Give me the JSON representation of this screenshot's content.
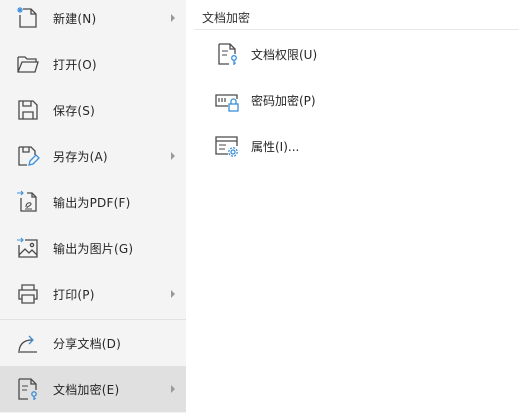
{
  "menu": {
    "items": [
      {
        "label": "新建(N)",
        "icon": "new-document-icon",
        "has_submenu": true
      },
      {
        "label": "打开(O)",
        "icon": "folder-open-icon",
        "has_submenu": false
      },
      {
        "label": "保存(S)",
        "icon": "save-icon",
        "has_submenu": false
      },
      {
        "label": "另存为(A)",
        "icon": "save-as-icon",
        "has_submenu": true
      },
      {
        "label": "输出为PDF(F)",
        "icon": "export-pdf-icon",
        "has_submenu": false
      },
      {
        "label": "输出为图片(G)",
        "icon": "export-image-icon",
        "has_submenu": false
      },
      {
        "label": "打印(P)",
        "icon": "printer-icon",
        "has_submenu": true
      },
      {
        "label": "分享文档(D)",
        "icon": "share-icon",
        "has_submenu": false
      },
      {
        "label": "文档加密(E)",
        "icon": "document-encrypt-icon",
        "has_submenu": true,
        "active": true
      }
    ]
  },
  "submenu": {
    "title": "文档加密",
    "items": [
      {
        "label": "文档权限(U)",
        "icon": "document-permission-icon"
      },
      {
        "label": "密码加密(P)",
        "icon": "password-lock-icon"
      },
      {
        "label": "属性(I)...",
        "icon": "properties-icon"
      }
    ]
  },
  "colors": {
    "menu_bg": "#f4f4f4",
    "active_bg": "#e0e0e0",
    "accent": "#3b8fd9",
    "icon_stroke": "#4a4a4a"
  }
}
